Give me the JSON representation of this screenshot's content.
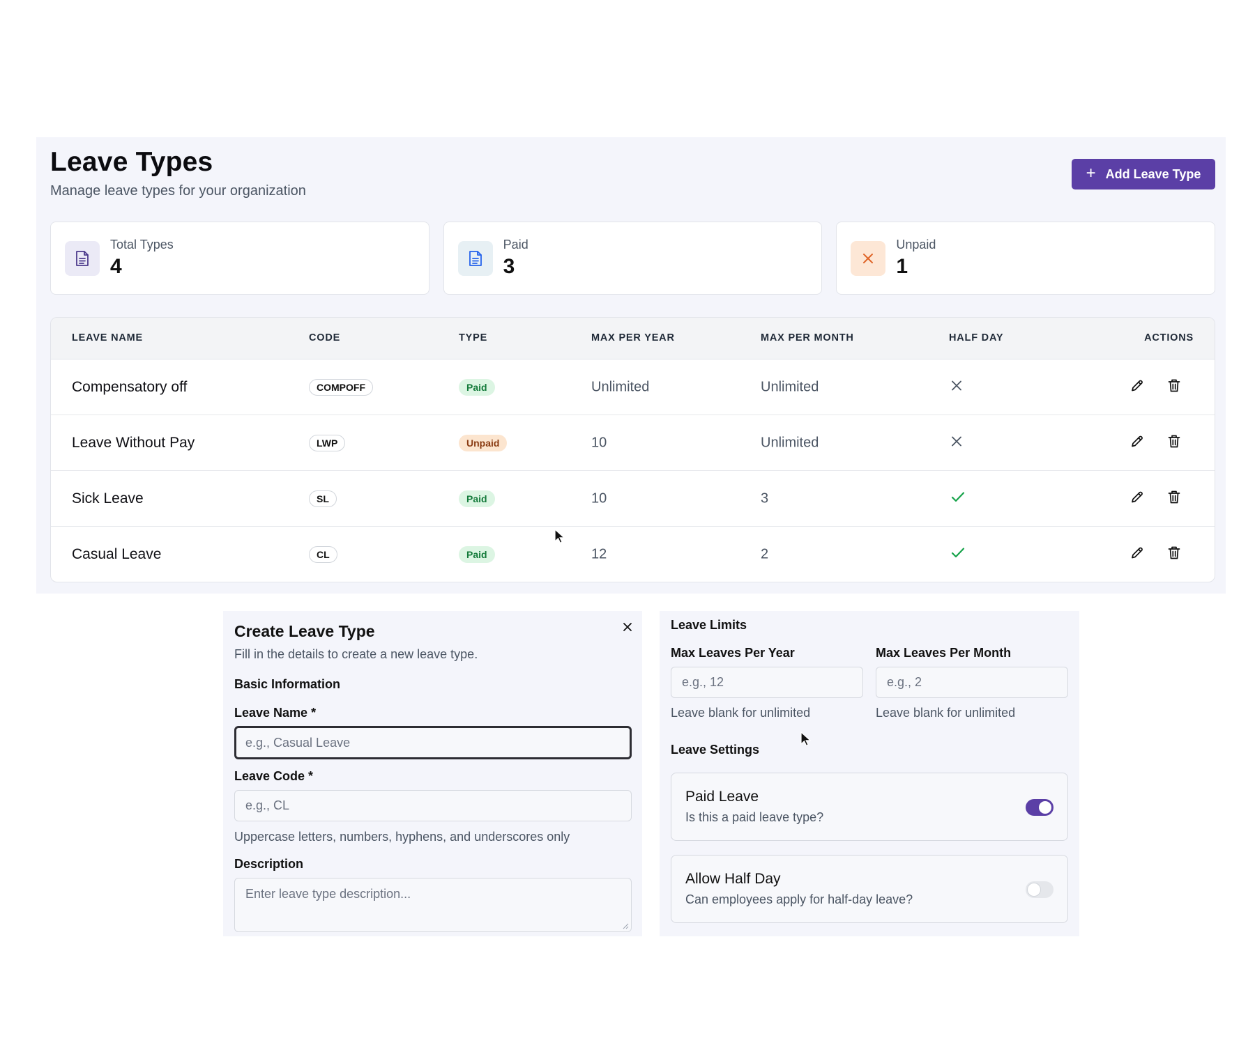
{
  "header": {
    "title": "Leave Types",
    "subtitle": "Manage leave types for your organization",
    "add_button": "Add Leave Type"
  },
  "stats": [
    {
      "label": "Total Types",
      "value": "4",
      "icon": "document-icon"
    },
    {
      "label": "Paid",
      "value": "3",
      "icon": "document-icon"
    },
    {
      "label": "Unpaid",
      "value": "1",
      "icon": "x-icon"
    }
  ],
  "table": {
    "columns": [
      "LEAVE NAME",
      "CODE",
      "TYPE",
      "MAX PER YEAR",
      "MAX PER MONTH",
      "HALF DAY",
      "ACTIONS"
    ],
    "rows": [
      {
        "name": "Compensatory off",
        "code": "COMPOFF",
        "type": "Paid",
        "max_year": "Unlimited",
        "max_month": "Unlimited",
        "half_day": false
      },
      {
        "name": "Leave Without Pay",
        "code": "LWP",
        "type": "Unpaid",
        "max_year": "10",
        "max_month": "Unlimited",
        "half_day": false
      },
      {
        "name": "Sick Leave",
        "code": "SL",
        "type": "Paid",
        "max_year": "10",
        "max_month": "3",
        "half_day": true
      },
      {
        "name": "Casual Leave",
        "code": "CL",
        "type": "Paid",
        "max_year": "12",
        "max_month": "2",
        "half_day": true
      }
    ]
  },
  "create_form": {
    "title": "Create Leave Type",
    "subtitle": "Fill in the details to create a new leave type.",
    "basic_info_title": "Basic Information",
    "name_label": "Leave Name *",
    "name_placeholder": "e.g., Casual Leave",
    "code_label": "Leave Code *",
    "code_placeholder": "e.g., CL",
    "code_hint": "Uppercase letters, numbers, hyphens, and underscores only",
    "description_label": "Description",
    "description_placeholder": "Enter leave type description..."
  },
  "limits": {
    "title": "Leave Limits",
    "year_label": "Max Leaves Per Year",
    "year_placeholder": "e.g., 12",
    "year_hint": "Leave blank for unlimited",
    "month_label": "Max Leaves Per Month",
    "month_placeholder": "e.g., 2",
    "month_hint": "Leave blank for unlimited",
    "settings_title": "Leave Settings",
    "paid_title": "Paid Leave",
    "paid_sub": "Is this a paid leave type?",
    "paid_on": true,
    "half_title": "Allow Half Day",
    "half_sub": "Can employees apply for half-day leave?",
    "half_on": false
  },
  "colors": {
    "accent": "#5b3fa6",
    "paid_badge_bg": "#dcf5e3",
    "unpaid_badge_bg": "#fce5cf",
    "check": "#16a34a"
  }
}
